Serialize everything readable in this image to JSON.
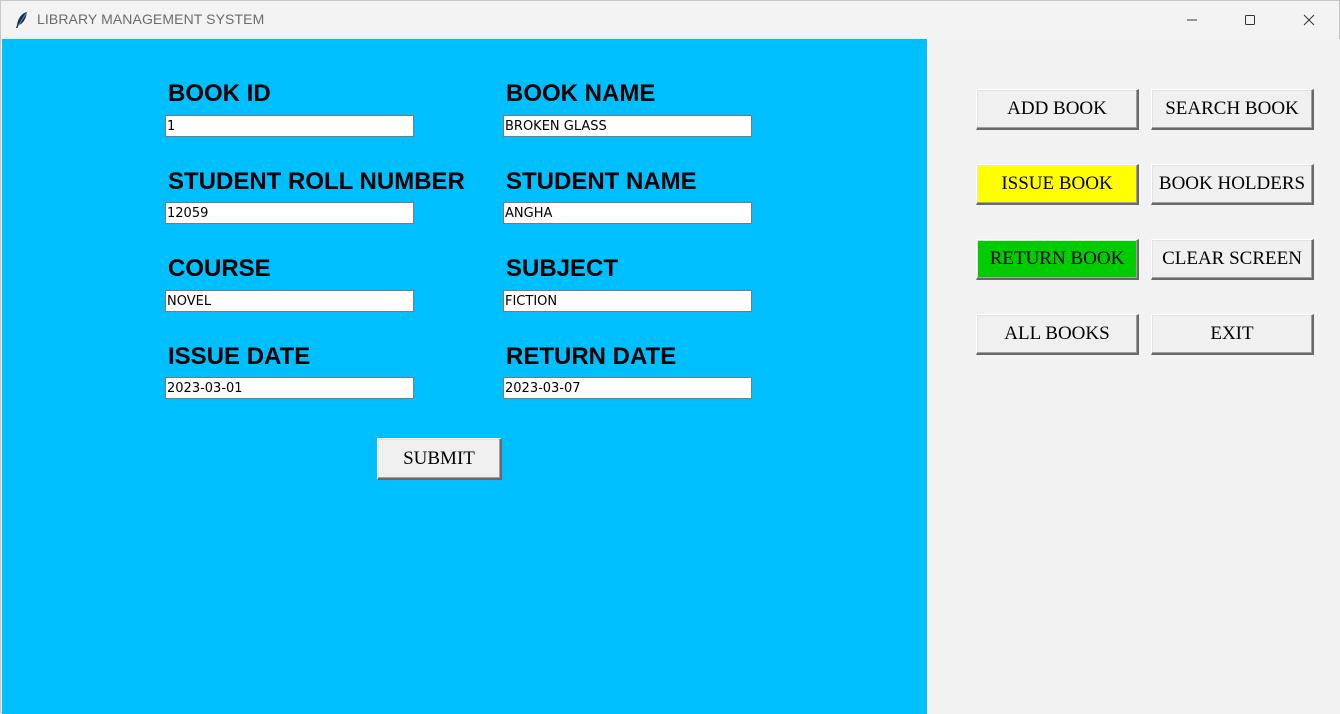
{
  "window": {
    "title": "LIBRARY MANAGEMENT SYSTEM",
    "icon": "feather-icon",
    "controls": [
      "minimize-icon",
      "maximize-icon",
      "close-icon"
    ]
  },
  "colors": {
    "form_background": "#00bfff",
    "sidebar_background": "#f2f2f2",
    "issue_button": "#ffff00",
    "return_button": "#00cc00"
  },
  "form": {
    "book_id": {
      "label": "BOOK ID",
      "value": "1"
    },
    "book_name": {
      "label": "BOOK NAME",
      "value": "BROKEN GLASS"
    },
    "student_roll": {
      "label": "STUDENT ROLL NUMBER",
      "value": "12059"
    },
    "student_name": {
      "label": "STUDENT NAME",
      "value": "ANGHA"
    },
    "course": {
      "label": "COURSE",
      "value": "NOVEL"
    },
    "subject": {
      "label": "SUBJECT",
      "value": "FICTION"
    },
    "issue_date": {
      "label": "ISSUE DATE",
      "value": "2023-03-01"
    },
    "return_date": {
      "label": "RETURN DATE",
      "value": "2023-03-07"
    },
    "submit_label": "SUBMIT"
  },
  "actions": {
    "add_book": "ADD BOOK",
    "search_book": "SEARCH BOOK",
    "issue_book": "ISSUE BOOK",
    "book_holders": "BOOK HOLDERS",
    "return_book": "RETURN BOOK",
    "clear_screen": "CLEAR SCREEN",
    "all_books": "ALL BOOKS",
    "exit": "EXIT"
  }
}
